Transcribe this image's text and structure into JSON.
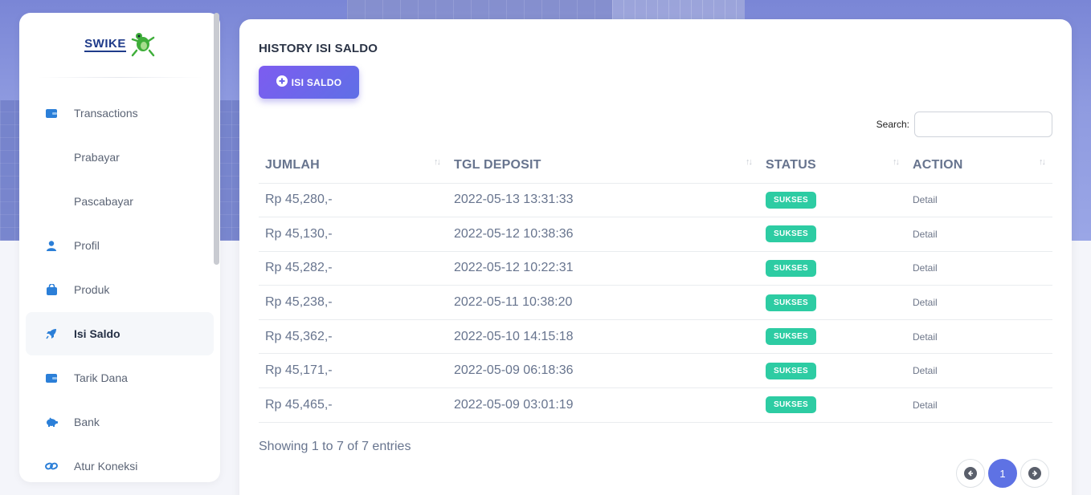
{
  "brand": {
    "name": "SWIKE",
    "logo_icon": "frog-icon"
  },
  "sidebar": {
    "items": [
      {
        "label": "Transactions",
        "icon": "wallet-icon"
      },
      {
        "label": "Prabayar",
        "icon": ""
      },
      {
        "label": "Pascabayar",
        "icon": ""
      },
      {
        "label": "Profil",
        "icon": "user-icon"
      },
      {
        "label": "Produk",
        "icon": "shopping-bag-icon"
      },
      {
        "label": "Isi Saldo",
        "icon": "rocket-icon",
        "active": true
      },
      {
        "label": "Tarik Dana",
        "icon": "wallet-icon"
      },
      {
        "label": "Bank",
        "icon": "piggy-bank-icon"
      },
      {
        "label": "Atur Koneksi",
        "icon": "link-icon"
      }
    ]
  },
  "main": {
    "title": "HISTORY ISI SALDO",
    "add_button": "ISI SALDO",
    "search_label": "Search:",
    "search_value": "",
    "columns": [
      "JUMLAH",
      "TGL DEPOSIT",
      "STATUS",
      "ACTION"
    ],
    "rows": [
      {
        "jumlah": "Rp 45,280,-",
        "tgl": "2022-05-13 13:31:33",
        "status": "SUKSES",
        "action": "Detail"
      },
      {
        "jumlah": "Rp 45,130,-",
        "tgl": "2022-05-12 10:38:36",
        "status": "SUKSES",
        "action": "Detail"
      },
      {
        "jumlah": "Rp 45,282,-",
        "tgl": "2022-05-12 10:22:31",
        "status": "SUKSES",
        "action": "Detail"
      },
      {
        "jumlah": "Rp 45,238,-",
        "tgl": "2022-05-11 10:38:20",
        "status": "SUKSES",
        "action": "Detail"
      },
      {
        "jumlah": "Rp 45,362,-",
        "tgl": "2022-05-10 14:15:18",
        "status": "SUKSES",
        "action": "Detail"
      },
      {
        "jumlah": "Rp 45,171,-",
        "tgl": "2022-05-09 06:18:36",
        "status": "SUKSES",
        "action": "Detail"
      },
      {
        "jumlah": "Rp 45,465,-",
        "tgl": "2022-05-09 03:01:19",
        "status": "SUKSES",
        "action": "Detail"
      }
    ],
    "info": "Showing 1 to 7 of 7 entries",
    "pagination": {
      "current": "1"
    }
  },
  "colors": {
    "accent": "#5e72e4",
    "success": "#2dcca3",
    "icon_blue": "#2b7fd8"
  }
}
